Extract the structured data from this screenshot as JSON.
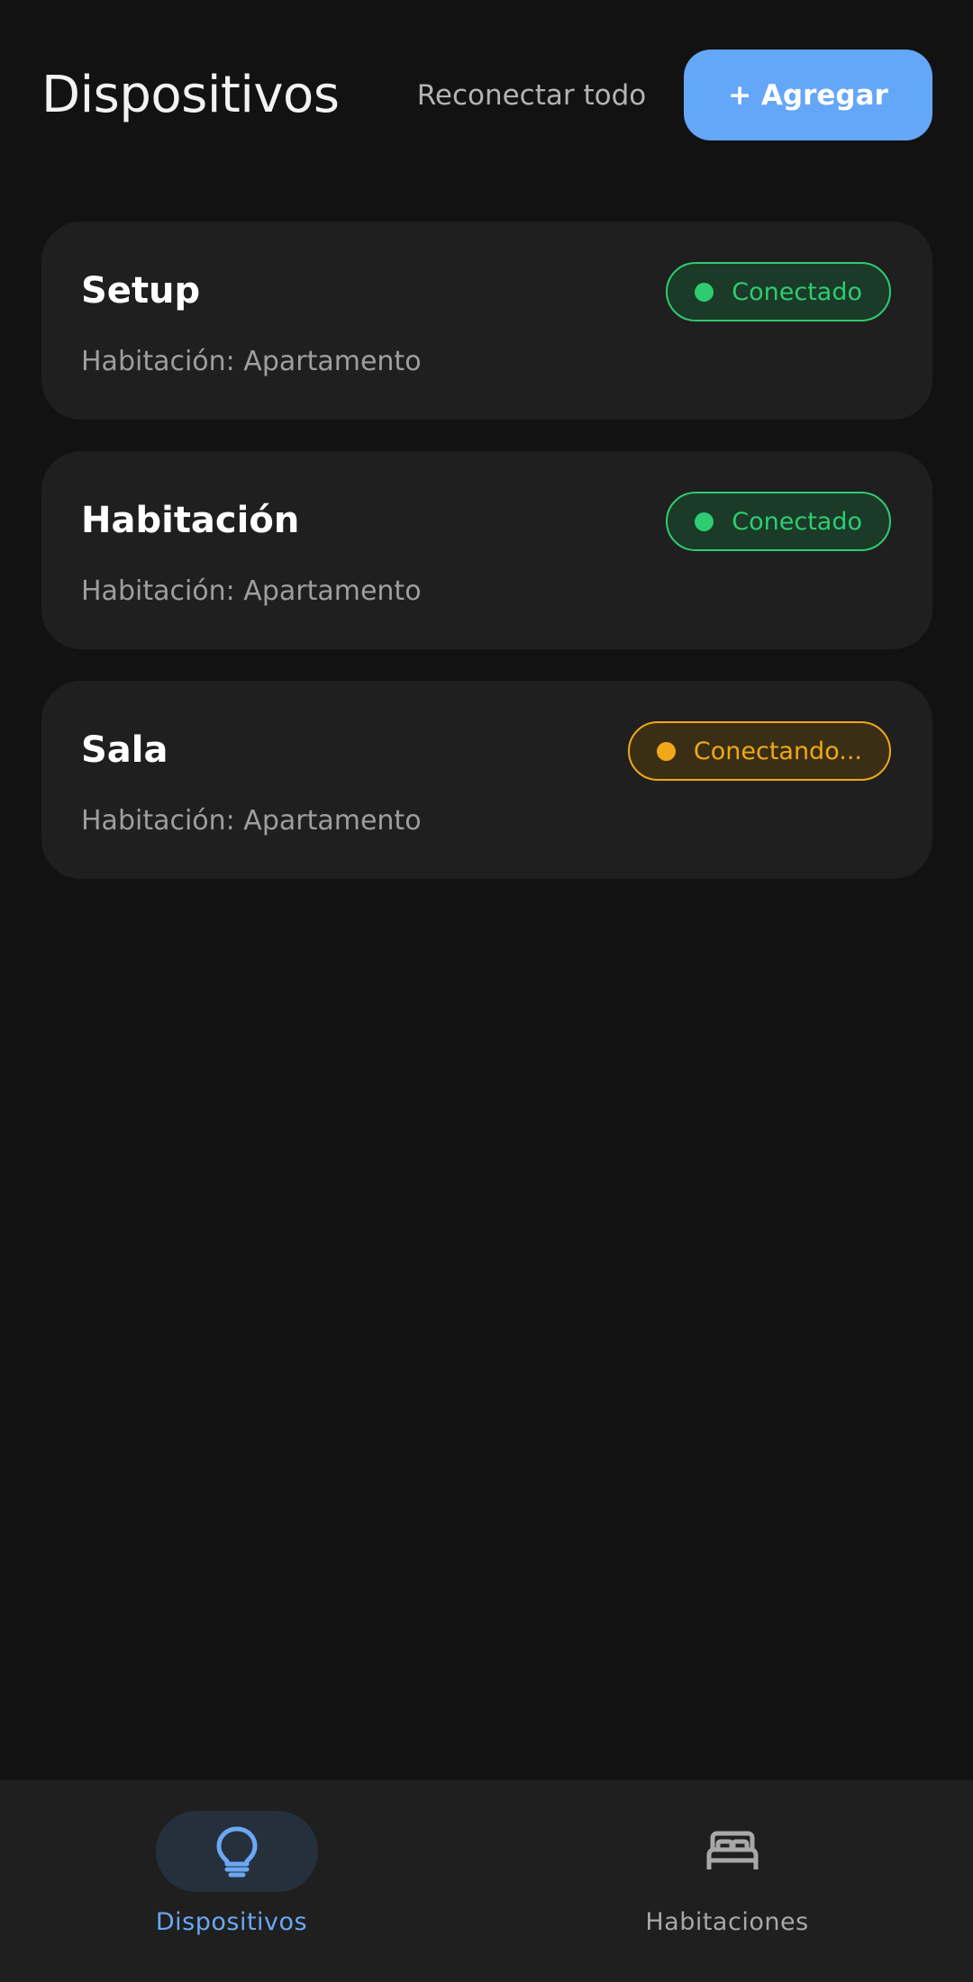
{
  "header": {
    "title": "Dispositivos",
    "reconnect_label": "Reconectar todo",
    "add_label": "+ Agregar"
  },
  "devices": [
    {
      "name": "Setup",
      "room": "Habitación: Apartamento",
      "status": "Conectado",
      "status_kind": "connected"
    },
    {
      "name": "Habitación",
      "room": "Habitación: Apartamento",
      "status": "Conectado",
      "status_kind": "connected"
    },
    {
      "name": "Sala",
      "room": "Habitación: Apartamento",
      "status": "Conectando...",
      "status_kind": "connecting"
    }
  ],
  "nav": {
    "items": [
      {
        "label": "Dispositivos",
        "icon": "lightbulb-icon",
        "active": true
      },
      {
        "label": "Habitaciones",
        "icon": "bed-icon",
        "active": false
      }
    ]
  },
  "colors": {
    "background": "#121212",
    "card": "#1f1f1f",
    "accent": "#64a6f8",
    "connected": "#2ecc71",
    "connecting": "#f0a818"
  }
}
